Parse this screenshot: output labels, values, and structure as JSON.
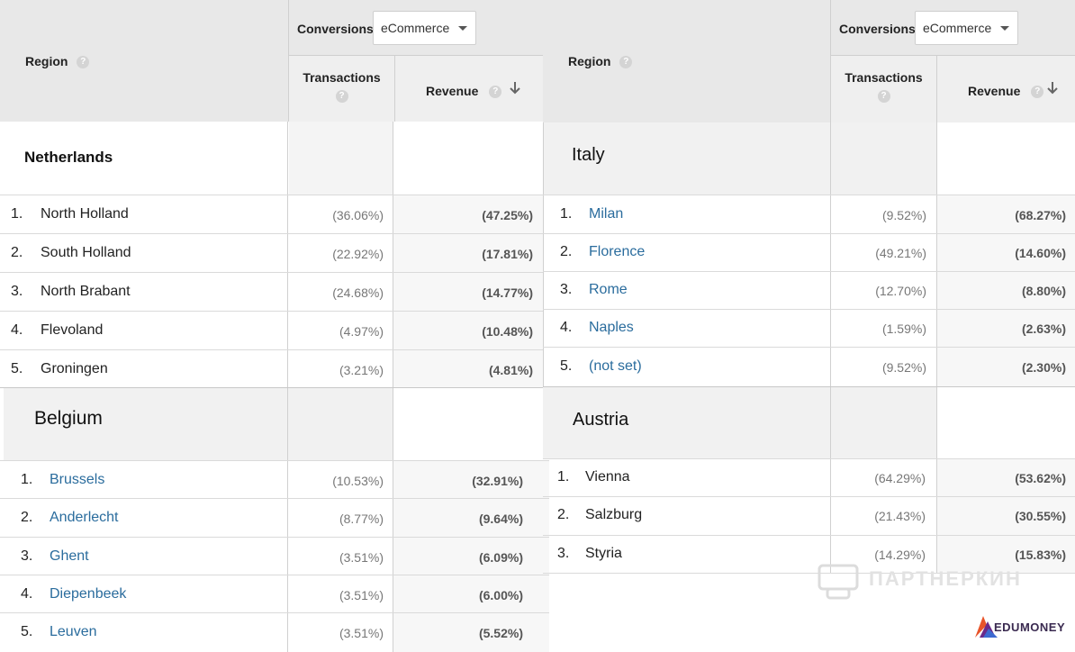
{
  "headers": {
    "region_label": "Region",
    "conversions_label": "Conversions",
    "dropdown_value": "eCommerce",
    "transactions_label": "Transactions",
    "revenue_label": "Revenue",
    "help_glyph": "?"
  },
  "panels": {
    "netherlands": {
      "country": "Netherlands",
      "rows": [
        {
          "num": "1.",
          "name": "North Holland",
          "transactions": "(36.06%)",
          "revenue": "(47.25%)"
        },
        {
          "num": "2.",
          "name": "South Holland",
          "transactions": "(22.92%)",
          "revenue": "(17.81%)"
        },
        {
          "num": "3.",
          "name": "North Brabant",
          "transactions": "(24.68%)",
          "revenue": "(14.77%)"
        },
        {
          "num": "4.",
          "name": "Flevoland",
          "transactions": "(4.97%)",
          "revenue": "(10.48%)"
        },
        {
          "num": "5.",
          "name": "Groningen",
          "transactions": "(3.21%)",
          "revenue": "(4.81%)"
        }
      ]
    },
    "belgium": {
      "country": "Belgium",
      "rows": [
        {
          "num": "1.",
          "name": "Brussels",
          "transactions": "(10.53%)",
          "revenue": "(32.91%)"
        },
        {
          "num": "2.",
          "name": "Anderlecht",
          "transactions": "(8.77%)",
          "revenue": "(9.64%)"
        },
        {
          "num": "3.",
          "name": "Ghent",
          "transactions": "(3.51%)",
          "revenue": "(6.09%)"
        },
        {
          "num": "4.",
          "name": "Diepenbeek",
          "transactions": "(3.51%)",
          "revenue": "(6.00%)"
        },
        {
          "num": "5.",
          "name": "Leuven",
          "transactions": "(3.51%)",
          "revenue": "(5.52%)"
        }
      ]
    },
    "italy": {
      "country": "Italy",
      "rows": [
        {
          "num": "1.",
          "name": "Milan",
          "transactions": "(9.52%)",
          "revenue": "(68.27%)"
        },
        {
          "num": "2.",
          "name": "Florence",
          "transactions": "(49.21%)",
          "revenue": "(14.60%)"
        },
        {
          "num": "3.",
          "name": "Rome",
          "transactions": "(12.70%)",
          "revenue": "(8.80%)"
        },
        {
          "num": "4.",
          "name": "Naples",
          "transactions": "(1.59%)",
          "revenue": "(2.63%)"
        },
        {
          "num": "5.",
          "name": "(not set)",
          "transactions": "(9.52%)",
          "revenue": "(2.30%)"
        }
      ]
    },
    "austria": {
      "country": "Austria",
      "rows": [
        {
          "num": "1.",
          "name": "Vienna",
          "transactions": "(64.29%)",
          "revenue": "(53.62%)"
        },
        {
          "num": "2.",
          "name": "Salzburg",
          "transactions": "(21.43%)",
          "revenue": "(30.55%)"
        },
        {
          "num": "3.",
          "name": "Styria",
          "transactions": "(14.29%)",
          "revenue": "(15.83%)"
        }
      ]
    }
  },
  "watermarks": {
    "partnerkin": "ПАРТНЕРКИН",
    "edumoney": "EDUMONEY"
  },
  "colors": {
    "link": "#2a6c9d",
    "header_bg": "#e8e8e8",
    "edumoney_accent": "#e8542a"
  }
}
